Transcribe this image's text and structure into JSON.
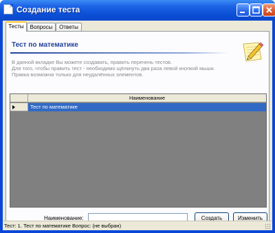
{
  "window": {
    "title": "Создание теста",
    "controls": {
      "minimize_icon": "minimize-icon",
      "maximize_icon": "maximize-icon",
      "close_icon": "close-icon"
    }
  },
  "tabs": [
    {
      "label": "Тесты",
      "active": true
    },
    {
      "label": "Вопросы",
      "active": false
    },
    {
      "label": "Ответы",
      "active": false
    }
  ],
  "page": {
    "title": "Тест по математике",
    "description_lines": [
      "В данной вкладке Вы можете создавать, править перечень тестов.",
      "Для того, чтобы править тест - необходимо щёлкнуть два раза левой кнопкой мыши.",
      "Правка возможна только для неудалённых элементов."
    ],
    "icon": "pencil-note-icon"
  },
  "grid": {
    "columns": [
      "Наименование"
    ],
    "rows": [
      {
        "name": "Тест по математике",
        "selected": true
      }
    ]
  },
  "form": {
    "name_label": "Наименование:",
    "name_value": "",
    "create_button": "Создать",
    "edit_button": "Изменить"
  },
  "status": {
    "text": "Тест: 1. Тест по математике  Вопрос: (не выбран)"
  },
  "colors": {
    "title_bar": "#0b4fd6",
    "selection": "#316ac5",
    "heading": "#20419a",
    "active_tab_accent": "#ffc83c"
  }
}
